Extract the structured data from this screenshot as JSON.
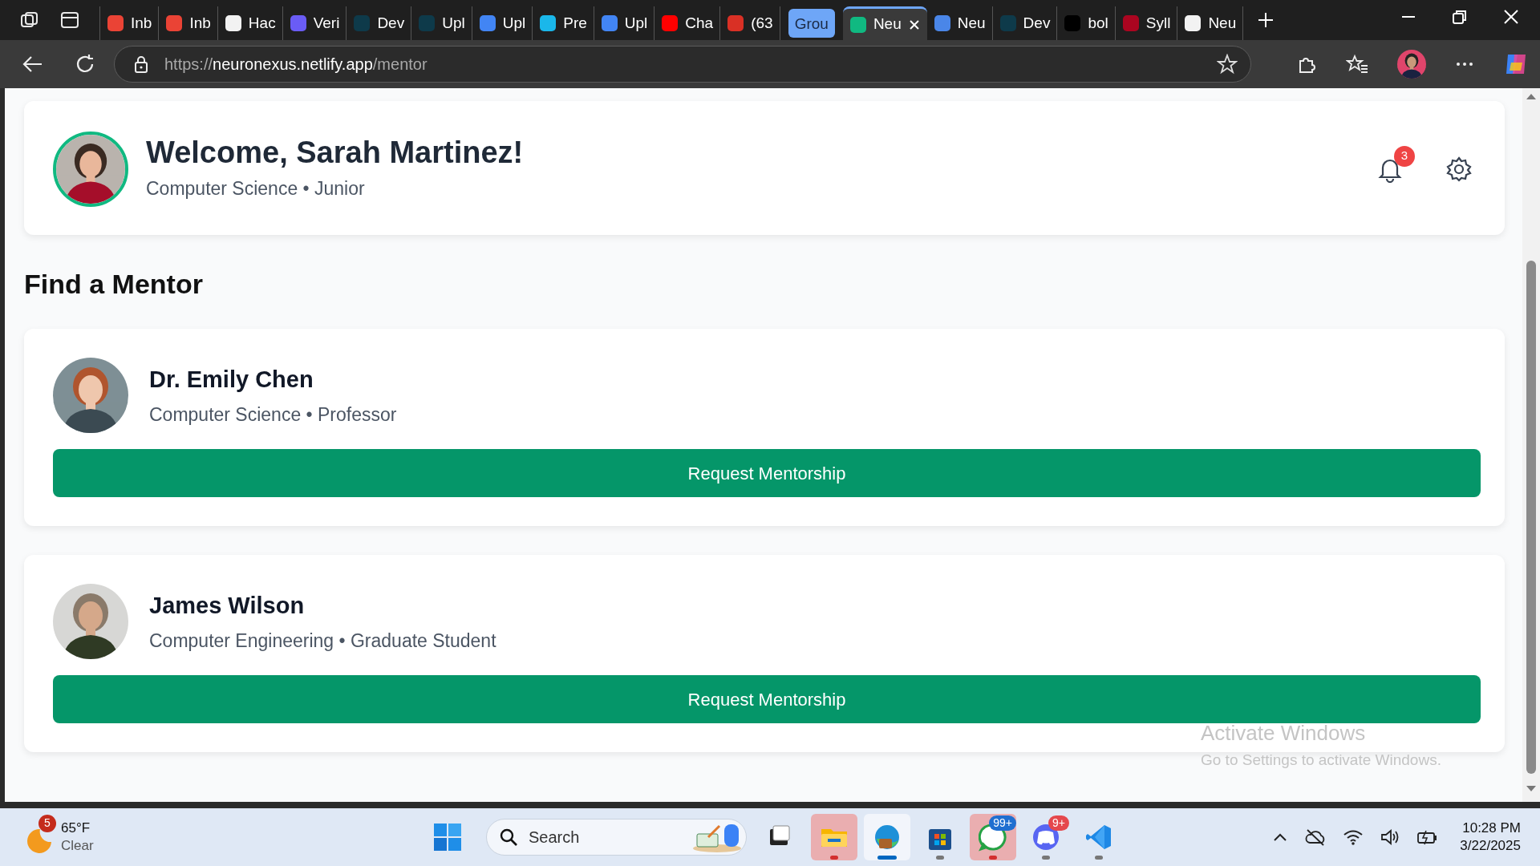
{
  "browser": {
    "tabs": [
      {
        "kind": "tab",
        "label": "Inb",
        "color": "#ea4335",
        "selected": false
      },
      {
        "kind": "tab",
        "label": "Inb",
        "color": "#ea4335",
        "selected": false
      },
      {
        "kind": "tab",
        "label": "Hac",
        "color": "#f2f2f2",
        "selected": false
      },
      {
        "kind": "tab",
        "label": "Veri",
        "color": "#6a5cf5",
        "selected": false
      },
      {
        "kind": "tab",
        "label": "Dev",
        "color": "#0e3a4a",
        "selected": false
      },
      {
        "kind": "tab",
        "label": "Upl",
        "color": "#0e3a4a",
        "selected": false
      },
      {
        "kind": "tab",
        "label": "Upl",
        "color": "#4285f4",
        "selected": false
      },
      {
        "kind": "tab",
        "label": "Pre",
        "color": "#1ab7ea",
        "selected": false
      },
      {
        "kind": "tab",
        "label": "Upl",
        "color": "#4285f4",
        "selected": false
      },
      {
        "kind": "tab",
        "label": "Cha",
        "color": "#ff0000",
        "selected": false
      },
      {
        "kind": "tab",
        "label": "(63",
        "color": "#d93025",
        "selected": false
      },
      {
        "kind": "group",
        "label": "Grou",
        "color": "#6ea6f7",
        "selected": false
      },
      {
        "kind": "tab",
        "label": "Neu",
        "color": "#10b981",
        "selected": true
      },
      {
        "kind": "tab",
        "label": "Neu",
        "color": "#4a86e8",
        "selected": false
      },
      {
        "kind": "tab",
        "label": "Dev",
        "color": "#0e3a4a",
        "selected": false
      },
      {
        "kind": "tab",
        "label": "bol",
        "color": "#000000",
        "selected": false
      },
      {
        "kind": "tab",
        "label": "Syll",
        "color": "#ab0520",
        "selected": false
      },
      {
        "kind": "tab",
        "label": "Neu",
        "color": "#f2f2f2",
        "selected": false
      }
    ],
    "url": {
      "scheme": "https://",
      "host": "neuronexus.netlify.app",
      "path": "/mentor"
    }
  },
  "page": {
    "header": {
      "title": "Welcome, Sarah Martinez!",
      "subtitle": "Computer Science • Junior",
      "notification_count": "3"
    },
    "section_title": "Find a Mentor",
    "mentors": [
      {
        "name": "Dr. Emily Chen",
        "subtitle": "Computer Science • Professor",
        "button": "Request Mentorship"
      },
      {
        "name": "James Wilson",
        "subtitle": "Computer Engineering • Graduate Student",
        "button": "Request Mentorship"
      }
    ]
  },
  "watermark": {
    "title": "Activate Windows",
    "subtitle": "Go to Settings to activate Windows."
  },
  "taskbar": {
    "weather": {
      "badge": "5",
      "temperature": "65°F",
      "condition": "Clear"
    },
    "search": {
      "placeholder": "Search"
    },
    "apps": [
      {
        "kind": "taskview",
        "attention": false,
        "active": false
      },
      {
        "kind": "folder",
        "attention": true,
        "active": false
      },
      {
        "kind": "browser",
        "attention": false,
        "active": true
      },
      {
        "kind": "store",
        "attention": false,
        "active": false
      },
      {
        "kind": "chat",
        "attention": true,
        "active": false,
        "badge": "99+"
      },
      {
        "kind": "discord",
        "attention": false,
        "active": false,
        "badge": "9+"
      },
      {
        "kind": "code",
        "attention": false,
        "active": false
      }
    ],
    "time": "10:28 PM",
    "date": "3/22/2025"
  }
}
